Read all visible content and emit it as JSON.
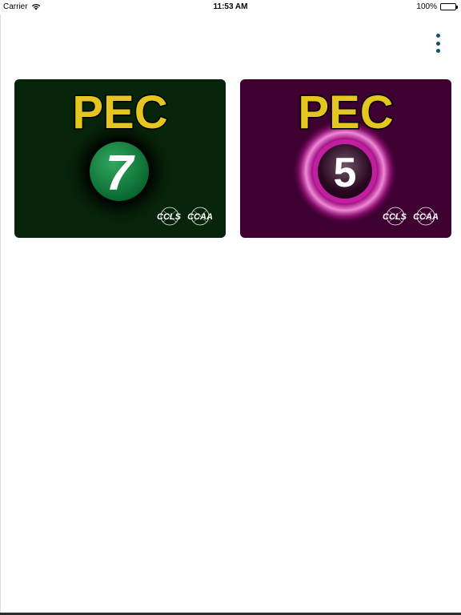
{
  "status_bar": {
    "carrier": "Carrier",
    "time": "11:53 AM",
    "battery": "100%"
  },
  "menu": {
    "icon": "more-vertical-icon",
    "color": "#0e4f78"
  },
  "cards": [
    {
      "title": "PEC",
      "number": "7",
      "logos": [
        "CCLS",
        "CCAA"
      ],
      "background": "#062409",
      "accent": "#0b7a3a"
    },
    {
      "title": "PEC",
      "number": "5",
      "logos": [
        "CCLS",
        "CCAA"
      ],
      "background": "#3e0031",
      "accent": "#c21fa0"
    }
  ]
}
